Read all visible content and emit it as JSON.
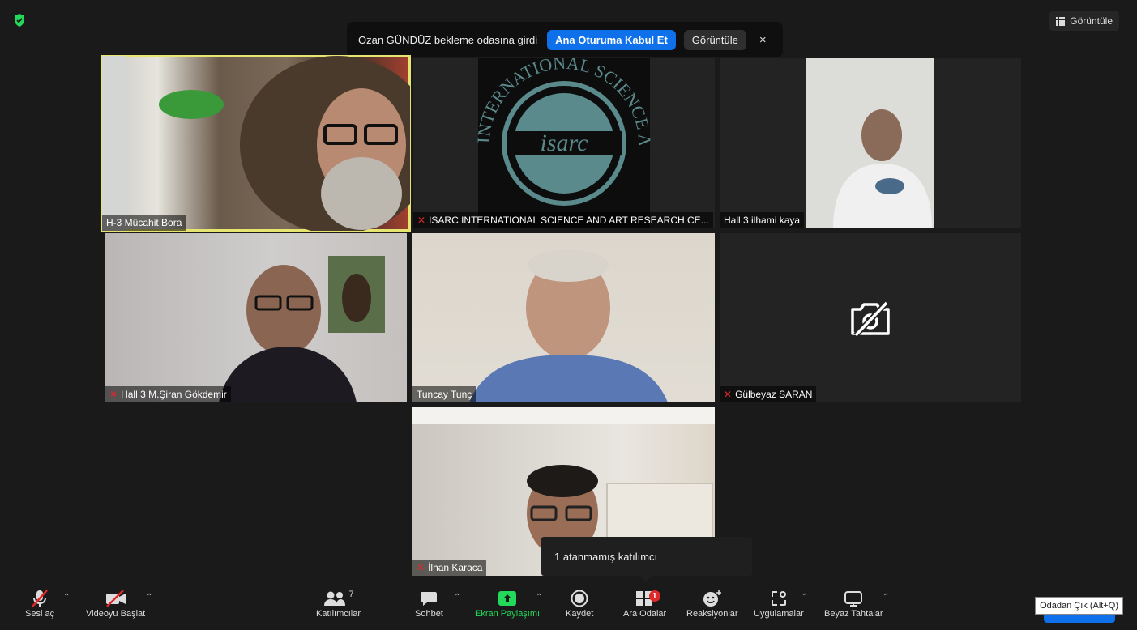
{
  "top_right": {
    "view_label": "Görüntüle"
  },
  "banner": {
    "message": "Ozan GÜNDÜZ bekleme odasına girdi",
    "admit_label": "Ana Oturuma Kabul Et",
    "view_label": "Görüntüle",
    "close_glyph": "×"
  },
  "tiles": [
    {
      "name": "H-3  Mücahit Bora"
    },
    {
      "name": "ISARC INTERNATIONAL SCIENCE AND ART RESEARCH CE...",
      "logo_text": "isarc",
      "logo_ring": "INTERNATIONAL SCIENCE AND ART RESEARCH CENTER"
    },
    {
      "name": "Hall 3 ilhami kaya"
    },
    {
      "name": "Hall 3 M.Şiran Gökdemir"
    },
    {
      "name": "Tuncay Tunç"
    },
    {
      "name": "Gülbeyaz SARAN"
    },
    {
      "name": "İlhan Karaca"
    }
  ],
  "tooltip": {
    "text": "1 atanmamış katılımcı"
  },
  "toolbar": {
    "unmute": "Sesi aç",
    "start_video": "Videoyu Başlat",
    "participants": "Katılımcılar",
    "participants_count": "7",
    "chat": "Sohbet",
    "share": "Ekran Paylaşımı",
    "record": "Kaydet",
    "breakout": "Ara Odalar",
    "breakout_badge": "1",
    "reactions": "Reaksiyonlar",
    "apps": "Uygulamalar",
    "whiteboards": "Beyaz Tahtalar",
    "leave_tooltip": "Odadan Çık (Alt+Q)"
  },
  "colors": {
    "accent": "#0e71eb",
    "share_green": "#23d959",
    "active_speaker": "#e6e56f",
    "muted_red": "#e02828"
  }
}
